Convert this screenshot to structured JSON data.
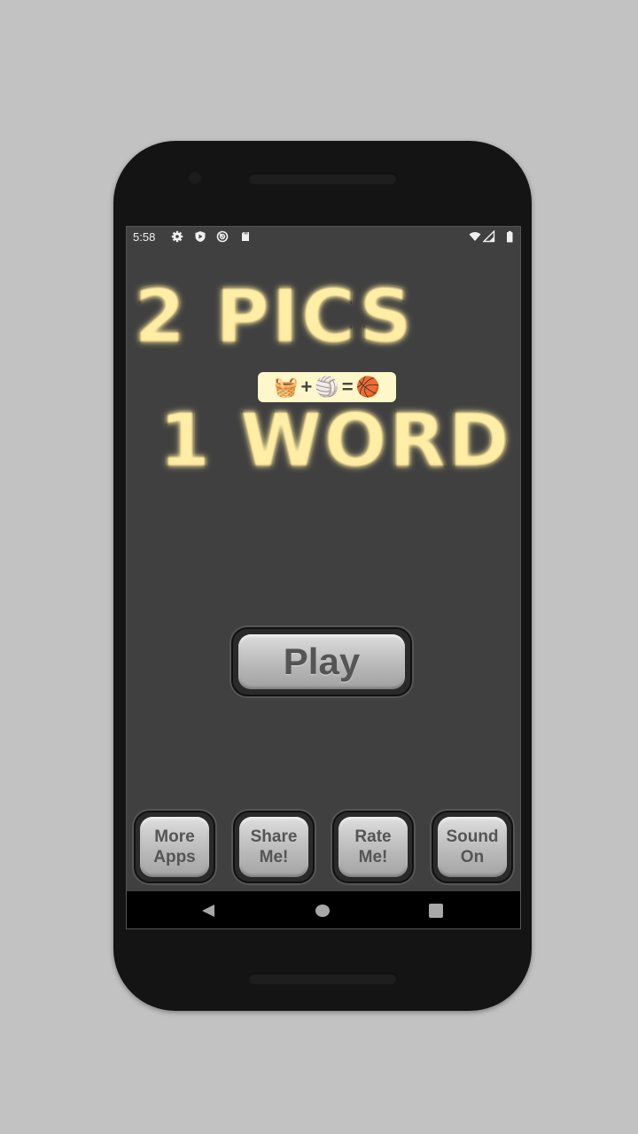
{
  "status_bar": {
    "time": "5:58",
    "left_icons": [
      "gear-icon",
      "shield-play-icon",
      "data-saver-icon",
      "sd-card-icon"
    ],
    "right_icons": [
      "wifi-icon",
      "signal-icon",
      "battery-icon"
    ]
  },
  "app": {
    "title_line1": "2 PICS",
    "title_line2": "1 WORD",
    "equation": {
      "item1": "🧺",
      "plus": "+",
      "item2": "🏐",
      "equals": "=",
      "result": "🏀"
    },
    "play_label": "Play",
    "buttons": [
      {
        "label": "More\nApps"
      },
      {
        "label": "Share\nMe!"
      },
      {
        "label": "Rate\nMe!"
      },
      {
        "label": "Sound\nOn"
      }
    ]
  },
  "nav_bar": {
    "back": "back-icon",
    "home": "home-icon",
    "recents": "recents-icon"
  },
  "colors": {
    "title_orange": "#f3971e",
    "screen_bg": "#404040",
    "button_gray": "#b8b8b8"
  }
}
